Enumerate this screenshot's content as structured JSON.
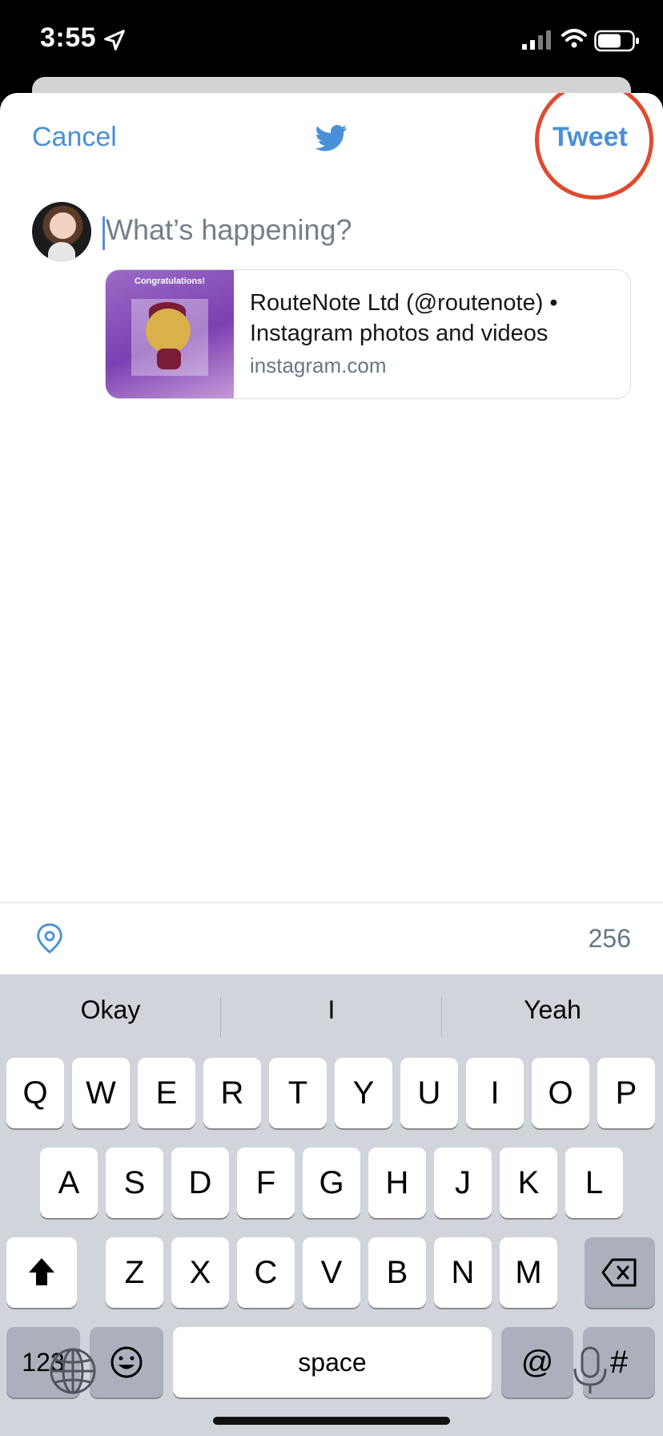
{
  "status_bar": {
    "time": "3:55"
  },
  "composer": {
    "cancel_label": "Cancel",
    "tweet_label": "Tweet",
    "placeholder": "What’s happening?",
    "link_card": {
      "thumbnail_text": "Congratulations!",
      "title": "RouteNote Ltd (@routenote) • Instagram photos and videos",
      "domain": "instagram.com"
    },
    "char_count": "256"
  },
  "keyboard": {
    "suggestions": [
      "Okay",
      "I",
      "Yeah"
    ],
    "row1": [
      "Q",
      "W",
      "E",
      "R",
      "T",
      "Y",
      "U",
      "I",
      "O",
      "P"
    ],
    "row2": [
      "A",
      "S",
      "D",
      "F",
      "G",
      "H",
      "J",
      "K",
      "L"
    ],
    "row3": [
      "Z",
      "X",
      "C",
      "V",
      "B",
      "N",
      "M"
    ],
    "bottom": {
      "numbers": "123",
      "space": "space",
      "at": "@",
      "hash": "#"
    }
  },
  "colors": {
    "accent": "#4A90D9",
    "annotation_circle": "#E04A2F"
  }
}
